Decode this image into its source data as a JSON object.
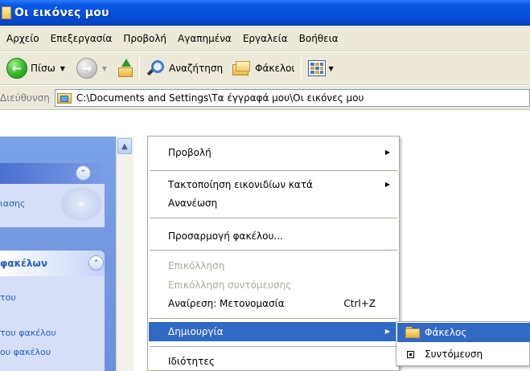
{
  "window": {
    "title": "Οι εικόνες μου"
  },
  "menubar": {
    "items": [
      "Αρχείο",
      "Επεξεργασία",
      "Προβολή",
      "Αγαπημένα",
      "Εργαλεία",
      "Βοήθεια"
    ]
  },
  "toolbar": {
    "back_label": "Πίσω",
    "search_label": "Αναζήτηση",
    "folders_label": "Φάκελοι"
  },
  "address": {
    "label": "Διεύθυνση",
    "path": "C:\\Documents and Settings\\Τα έγγραφά μου\\Οι εικόνες μου"
  },
  "taskpane": {
    "section1_link": "ιασης",
    "section2_header": "φακέλων",
    "section2_links": [
      "του",
      "του φακέλου",
      "ου φακέλου"
    ]
  },
  "context_menu": {
    "items": [
      {
        "label": "Προβολή",
        "submenu": true,
        "disabled": false
      },
      {
        "label": "Τακτοποίηση εικονιδίων κατά",
        "submenu": true,
        "disabled": false
      },
      {
        "label": "Ανανέωση",
        "submenu": false,
        "disabled": false
      },
      {
        "label": "Προσαρμογή φακέλου...",
        "submenu": false,
        "disabled": false
      },
      {
        "label": "Επικόλληση",
        "submenu": false,
        "disabled": true
      },
      {
        "label": "Επικόλληση συντόμευσης",
        "submenu": false,
        "disabled": true
      },
      {
        "label": "Αναίρεση: Μετονομασία",
        "shortcut": "Ctrl+Z",
        "submenu": false,
        "disabled": false
      },
      {
        "label": "Δημιουργία",
        "submenu": true,
        "disabled": false,
        "selected": true
      },
      {
        "label": "Ιδιότητες",
        "submenu": false,
        "disabled": false
      }
    ]
  },
  "submenu": {
    "items": [
      {
        "label": "Φάκελος",
        "icon": "folder-icon",
        "selected": true
      },
      {
        "label": "Συντόμευση",
        "icon": "shortcut-icon",
        "selected": false
      }
    ]
  },
  "colors": {
    "titlebar": "#0550dc",
    "menu_highlight": "#316ac5",
    "taskpane": "#6d8fd9",
    "link": "#215dc6",
    "disabled_text": "#aca899"
  }
}
